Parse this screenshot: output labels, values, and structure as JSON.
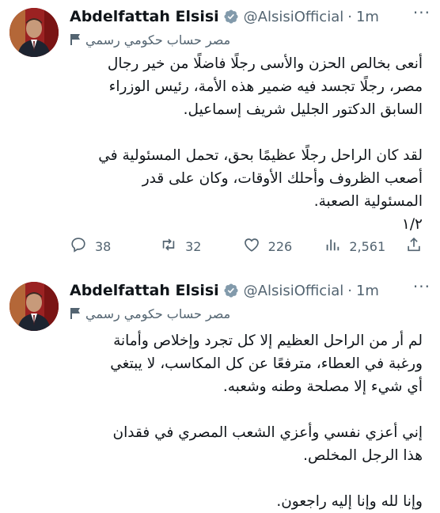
{
  "tweets": [
    {
      "author_name": "Abdelfattah Elsisi",
      "handle": "@AlsisiOfficial",
      "separator": "·",
      "time": "1m",
      "more_label": "···",
      "gov_label": "مصر حساب حكومي رسمي",
      "body": "أنعى بخالص الحزن والأسى رجلًا فاضلًا من خير رجال\nمصر، رجلًا تجسد فيه ضمير هذه الأمة، رئيس الوزراء\nالسابق الدكتور الجليل شريف إسماعيل.\n\nلقد كان الراحل رجلًا عظيمًا بحق، تحمل المسئولية في\nأصعب الظروف وأحلك الأوقات، وكان على قدر\nالمسئولية الصعبة.\n١/٢",
      "reply_count": "38",
      "retweet_count": "32",
      "like_count": "226",
      "view_count": "2,561"
    },
    {
      "author_name": "Abdelfattah Elsisi",
      "handle": "@AlsisiOfficial",
      "separator": "·",
      "time": "1m",
      "more_label": "···",
      "gov_label": "مصر حساب حكومي رسمي",
      "body": "لم أر من الراحل العظيم إلا كل تجرد وإخلاص وأمانة\nورغبة في العطاء، مترفعًا عن كل المكاسب، لا يبتغي\nأي شيء إلا مصلحة وطنه وشعبه.\n\nإني أعزي نفسي وأعزي الشعب المصري في فقدان\nهذا الرجل المخلص.\n\nوإنا لله وإنا إليه راجعون."
    }
  ],
  "colors": {
    "text": "#0f1419",
    "secondary": "#536471",
    "verified": "#829aab",
    "background": "#ffffff"
  },
  "icons": [
    "verified-badge-icon",
    "flag-icon",
    "reply-icon",
    "retweet-icon",
    "like-icon",
    "views-icon",
    "share-icon",
    "more-icon"
  ]
}
